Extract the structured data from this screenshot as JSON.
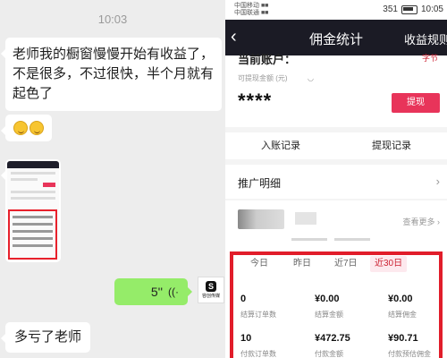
{
  "chat": {
    "time": "10:03",
    "message1": "老师我的橱窗慢慢开始有收益了，不是很多，不过很快，半个月就有起色了",
    "voice_duration": "5''",
    "voice_wave": "((·",
    "avatar_brand": "S",
    "avatar_text": "容创传媒",
    "message3": "多亏了老师"
  },
  "phone": {
    "status": {
      "carrier_line1": "中国移动 ■■",
      "carrier_line2": "中国联通 ■■",
      "speed": "351",
      "battery": "10:05"
    },
    "nav": {
      "back_icon": "‹",
      "title": "佣金统计",
      "right_link": "收益规则"
    },
    "account_label": "当前账户：",
    "account_right": "字节",
    "withdrawable_label": "可提现金额 (元)",
    "eye_icon": "◡",
    "withdrawable_masked": "****",
    "withdraw_button": "提现",
    "links": {
      "income_record": "入账记录",
      "withdraw_record": "提现记录"
    },
    "promo_detail": "推广明细",
    "chevron": "›",
    "see_more": "查看更多 ›",
    "tabs": [
      {
        "label": "今日",
        "active": false
      },
      {
        "label": "昨日",
        "active": false
      },
      {
        "label": "近7日",
        "active": false
      },
      {
        "label": "近30日",
        "active": true
      }
    ],
    "stats": [
      {
        "value": "0",
        "label": "结算订单数"
      },
      {
        "value": "¥0.00",
        "label": "结算金额"
      },
      {
        "value": "¥0.00",
        "label": "结算佣金"
      },
      {
        "value": "10",
        "label": "付款订单数"
      },
      {
        "value": "¥472.75",
        "label": "付款金额"
      },
      {
        "value": "¥90.71",
        "label": "付款预估佣金"
      }
    ],
    "accent_color": "#e8345a",
    "highlight_color": "#e11d2a"
  }
}
